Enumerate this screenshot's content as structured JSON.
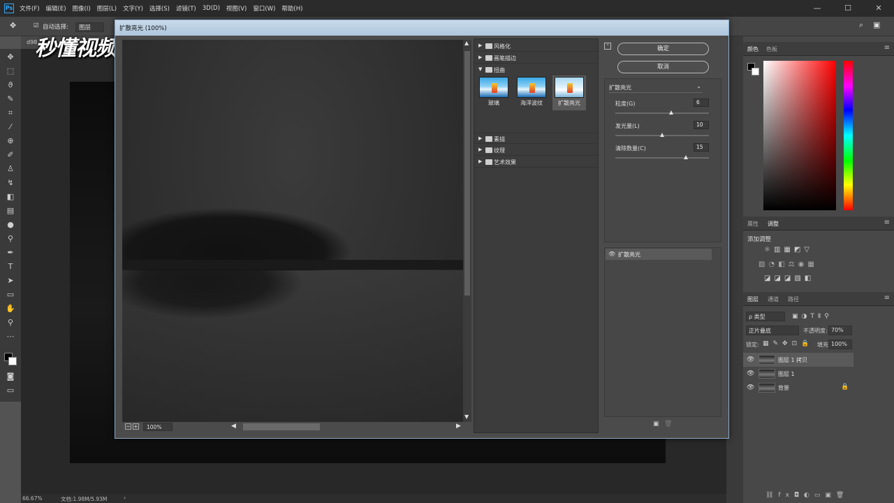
{
  "menubar": {
    "logo": "Ps",
    "items": [
      "文件(F)",
      "编辑(E)",
      "图像(I)",
      "图层(L)",
      "文字(Y)",
      "选择(S)",
      "滤镜(T)",
      "3D(D)",
      "视图(V)",
      "窗口(W)",
      "帮助(H)"
    ],
    "min": "—",
    "max": "☐",
    "close": "✕"
  },
  "options": {
    "auto_select": "自动选择:",
    "layer": "图层",
    "checkbox": "☑"
  },
  "watermark": "秒懂视频",
  "doc": {
    "tab": "d98",
    "zoom": "66.67%",
    "docinfo": "文档:1.98M/5.93M"
  },
  "dialog": {
    "title": "扩散亮光 (100%)",
    "ok": "确定",
    "cancel": "取消",
    "preview_zoom": "100%",
    "gallery": {
      "groups_top": [
        "风格化",
        "画笔描边",
        "扭曲"
      ],
      "thumbs": [
        "玻璃",
        "海洋波纹",
        "扩散亮光"
      ],
      "groups_bottom": [
        "素描",
        "纹理",
        "艺术效果"
      ]
    },
    "filter_select": "扩散亮光",
    "params": [
      {
        "label": "粒度(G)",
        "value": "6"
      },
      {
        "label": "发光量(L)",
        "value": "10"
      },
      {
        "label": "清除数量(C)",
        "value": "15"
      }
    ],
    "param_levels": [
      0.6,
      0.5,
      0.75
    ],
    "effect_layer": "扩散亮光"
  },
  "panels": {
    "color_tabs": [
      "颜色",
      "色板"
    ],
    "adj_tabs": [
      "属性",
      "调整"
    ],
    "add_adjustment": "添加调整",
    "layer_tabs": [
      "图层",
      "通道",
      "路径"
    ],
    "kind": "ρ 类型",
    "blend": "正片叠底",
    "opacity_label": "不透明度:",
    "opacity": "70%",
    "lock_label": "锁定:",
    "fill_label": "填充:",
    "fill": "100%",
    "layers": [
      "图层 1 拷贝",
      "图层 1",
      "背景"
    ]
  }
}
